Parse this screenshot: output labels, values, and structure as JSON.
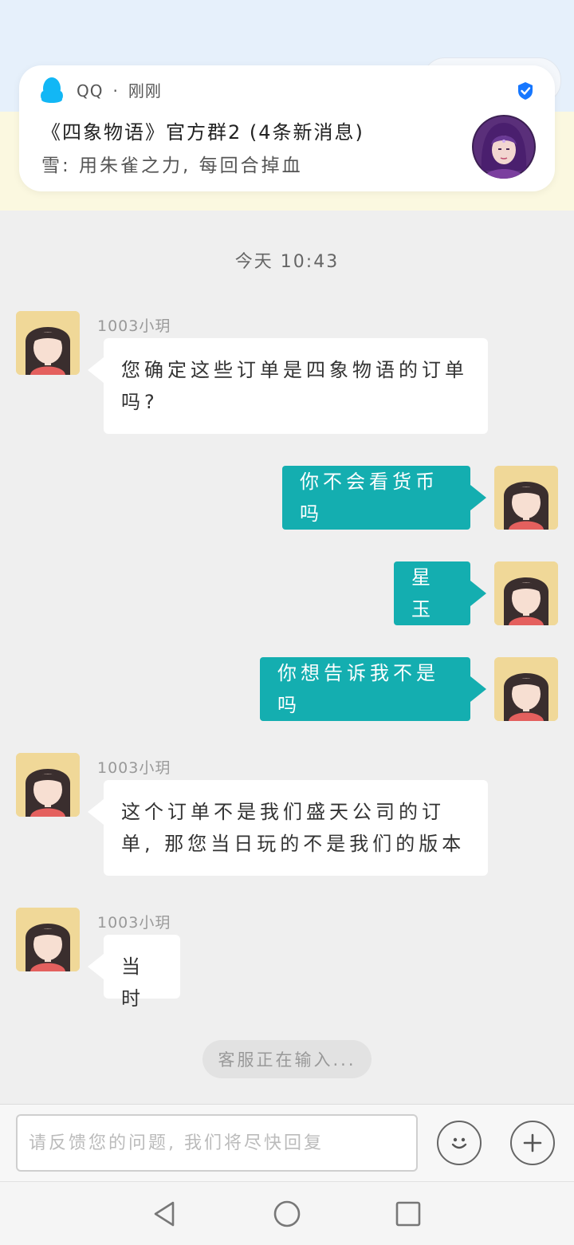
{
  "colors": {
    "accent": "#14aeb0",
    "qq_blue": "#12b7f5",
    "verified_blue": "#1677ff",
    "avatar_bg": "#f0d898"
  },
  "notification": {
    "app_name": "QQ",
    "separator": "·",
    "time": "刚刚",
    "title": "《四象物语》官方群2 (4条新消息)",
    "preview": "雪: 用朱雀之力, 每回合掉血",
    "icons": {
      "app": "qq-penguin-icon",
      "badge": "verified-shield-icon",
      "avatar": "group-avatar"
    }
  },
  "chat": {
    "time_label": "今天 10:43",
    "agent_name": "1003小玥",
    "messages": [
      {
        "direction": "in",
        "sender": "1003小玥",
        "text": "您确定这些订单是四象物语的订单吗?"
      },
      {
        "direction": "out",
        "text": "你不会看货币吗"
      },
      {
        "direction": "out",
        "text": "星玉"
      },
      {
        "direction": "out",
        "text": "你想告诉我不是吗"
      },
      {
        "direction": "in",
        "sender": "1003小玥",
        "text": "这个订单不是我们盛天公司的订单, 那您当日玩的不是我们的版本"
      },
      {
        "direction": "in",
        "sender": "1003小玥",
        "text": "当时"
      }
    ],
    "typing_indicator": "客服正在输入..."
  },
  "composer": {
    "value": "",
    "placeholder": "请反馈您的问题, 我们将尽快回复",
    "emoji_icon": "smiley-icon",
    "plus_icon": "plus-icon"
  },
  "system_nav": {
    "back_icon": "back-triangle-icon",
    "home_icon": "home-circle-icon",
    "recents_icon": "recents-square-icon"
  }
}
